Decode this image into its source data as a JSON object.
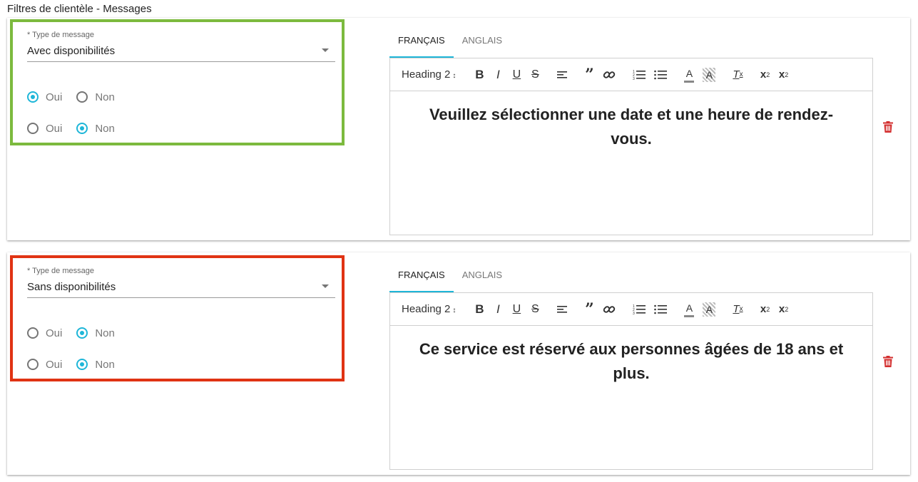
{
  "page_title": "Filtres de clientèle - Messages",
  "colors": {
    "accent": "#1eb6d8",
    "valid_border": "#7cba3e",
    "error_border": "#e03313",
    "delete": "#d32f2f"
  },
  "cards": [
    {
      "select": {
        "label": "* Type de message",
        "value": "Avec disponibilités"
      },
      "radio_rows": [
        {
          "options": [
            {
              "label": "Oui",
              "checked": true
            },
            {
              "label": "Non",
              "checked": false
            }
          ]
        },
        {
          "options": [
            {
              "label": "Oui",
              "checked": false
            },
            {
              "label": "Non",
              "checked": true
            }
          ]
        }
      ],
      "tabs": [
        {
          "label": "FRANÇAIS",
          "active": true
        },
        {
          "label": "ANGLAIS",
          "active": false
        }
      ],
      "toolbar": {
        "heading": "Heading 2"
      },
      "content": "Veuillez sélectionner une date et une heure de rendez-vous."
    },
    {
      "select": {
        "label": "* Type de message",
        "value": "Sans disponibilités"
      },
      "radio_rows": [
        {
          "options": [
            {
              "label": "Oui",
              "checked": false
            },
            {
              "label": "Non",
              "checked": true
            }
          ]
        },
        {
          "options": [
            {
              "label": "Oui",
              "checked": false
            },
            {
              "label": "Non",
              "checked": true
            }
          ]
        }
      ],
      "tabs": [
        {
          "label": "FRANÇAIS",
          "active": true
        },
        {
          "label": "ANGLAIS",
          "active": false
        }
      ],
      "toolbar": {
        "heading": "Heading 2"
      },
      "content": "Ce service est réservé aux personnes âgées de 18 ans et plus."
    }
  ]
}
